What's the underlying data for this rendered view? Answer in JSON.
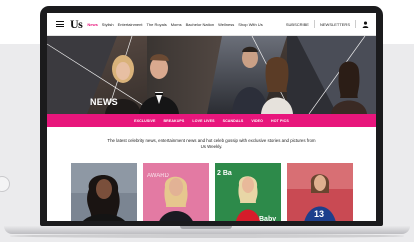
{
  "site": {
    "logo": "Us",
    "nav": [
      "News",
      "Stylish",
      "Entertainment",
      "The Royals",
      "Moms",
      "Bachelor Nation",
      "Wellness",
      "Shop With Us"
    ],
    "active_nav": "News",
    "subscribe": "SUBSCRIBE",
    "newsletters": "NEWSLETTERS"
  },
  "hero": {
    "title": "NEWS"
  },
  "subnav": [
    "EXCLUSIVE",
    "BREAKUPS",
    "LOVE LIVES",
    "SCANDALS",
    "VIDEO",
    "HOT PICS"
  ],
  "tagline": "The latest celebrity news, entertainment news and hot celeb gossip with exclusive stories and pictures from Us Weekly.",
  "colors": {
    "brand_pink": "#e8167c",
    "bezel": "#1b1b1d",
    "backdrop": "#ebebed"
  },
  "icons": {
    "menu": "hamburger-icon",
    "account": "user-icon"
  }
}
